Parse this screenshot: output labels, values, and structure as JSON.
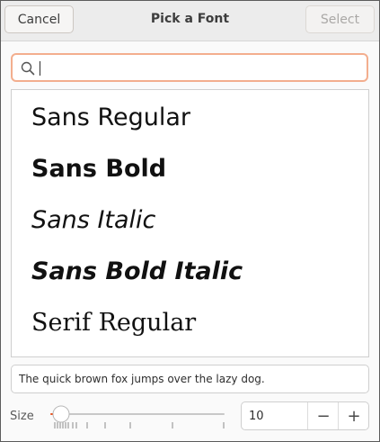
{
  "header": {
    "title": "Pick a Font",
    "cancel_label": "Cancel",
    "select_label": "Select"
  },
  "search": {
    "value": "",
    "placeholder": "",
    "icon": "search-icon"
  },
  "font_list": {
    "items": [
      {
        "label": "Sans Regular"
      },
      {
        "label": "Sans Bold"
      },
      {
        "label": "Sans Italic"
      },
      {
        "label": "Sans Bold Italic"
      },
      {
        "label": "Serif Regular"
      }
    ]
  },
  "preview": {
    "text": "The quick brown fox jumps over the lazy dog."
  },
  "size": {
    "label": "Size",
    "value": "10",
    "minus_label": "−",
    "plus_label": "+"
  },
  "colors": {
    "focus_border": "#f3ae8e",
    "slider_accent": "#e95420"
  }
}
